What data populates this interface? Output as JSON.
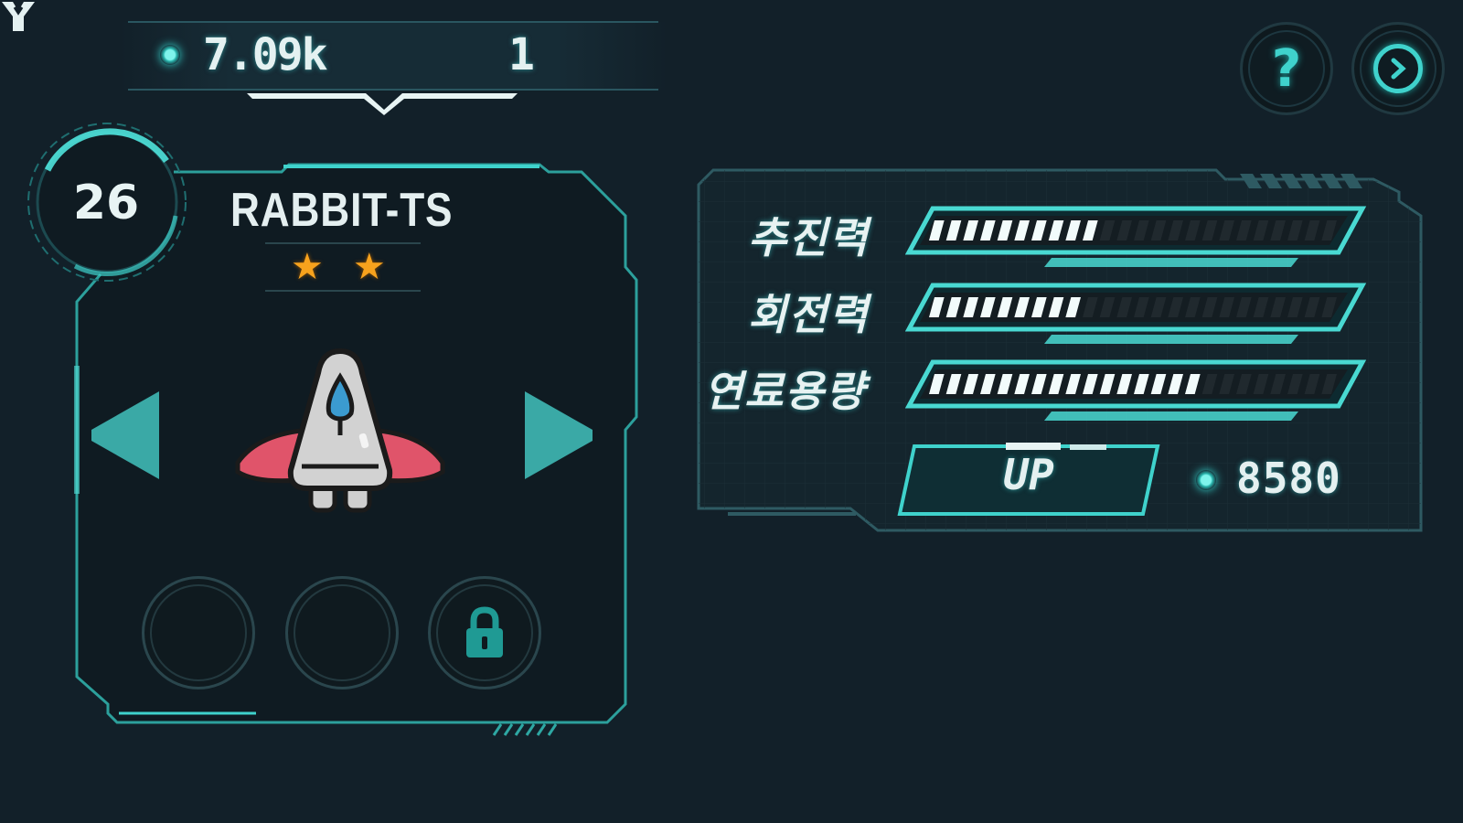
{
  "currency": {
    "coins": "7.09k",
    "trophies": "1"
  },
  "top_buttons": {
    "help_icon": "question-icon",
    "next_icon": "chevron-right-icon"
  },
  "ship": {
    "level": "26",
    "name": "RABBIT-TS",
    "stars": 2,
    "star_glyph": "★",
    "slots": [
      "empty",
      "empty",
      "locked"
    ]
  },
  "stats": [
    {
      "label": "추진력",
      "fill": 0.42
    },
    {
      "label": "회전력",
      "fill": 0.37
    },
    {
      "label": "연료용량",
      "fill": 0.66
    }
  ],
  "upgrade": {
    "button_label": "UP",
    "cost": "8580"
  },
  "colors": {
    "background": "#122029",
    "accent": "#3fd2cc",
    "star": "#f7a21d",
    "ship_wing": "#e0546a"
  }
}
